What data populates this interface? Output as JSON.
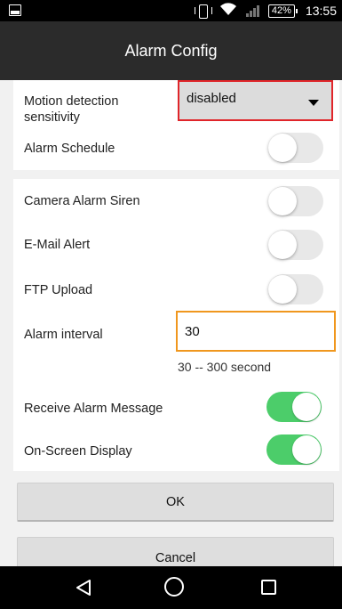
{
  "status_bar": {
    "battery": "42%",
    "time": "13:55"
  },
  "app_bar": {
    "title": "Alarm Config"
  },
  "motion_detection": {
    "label": "Motion detection sensitivity",
    "selected": "disabled"
  },
  "alarm_schedule": {
    "label": "Alarm Schedule",
    "enabled": false
  },
  "camera_alarm_siren": {
    "label": "Camera Alarm Siren",
    "enabled": false
  },
  "email_alert": {
    "label": "E-Mail Alert",
    "enabled": false
  },
  "ftp_upload": {
    "label": "FTP Upload",
    "enabled": false
  },
  "alarm_interval": {
    "label": "Alarm interval",
    "value": "30",
    "hint": "30 -- 300 second"
  },
  "receive_alarm_message": {
    "label": "Receive Alarm Message",
    "enabled": true
  },
  "on_screen_display": {
    "label": "On-Screen Display",
    "enabled": true
  },
  "buttons": {
    "ok": "OK",
    "cancel": "Cancel"
  },
  "colors": {
    "toggle_on": "#4ccd6a",
    "dropdown_border": "#e0252a",
    "input_border": "#f0971e",
    "app_bar": "#2b2b2b"
  }
}
